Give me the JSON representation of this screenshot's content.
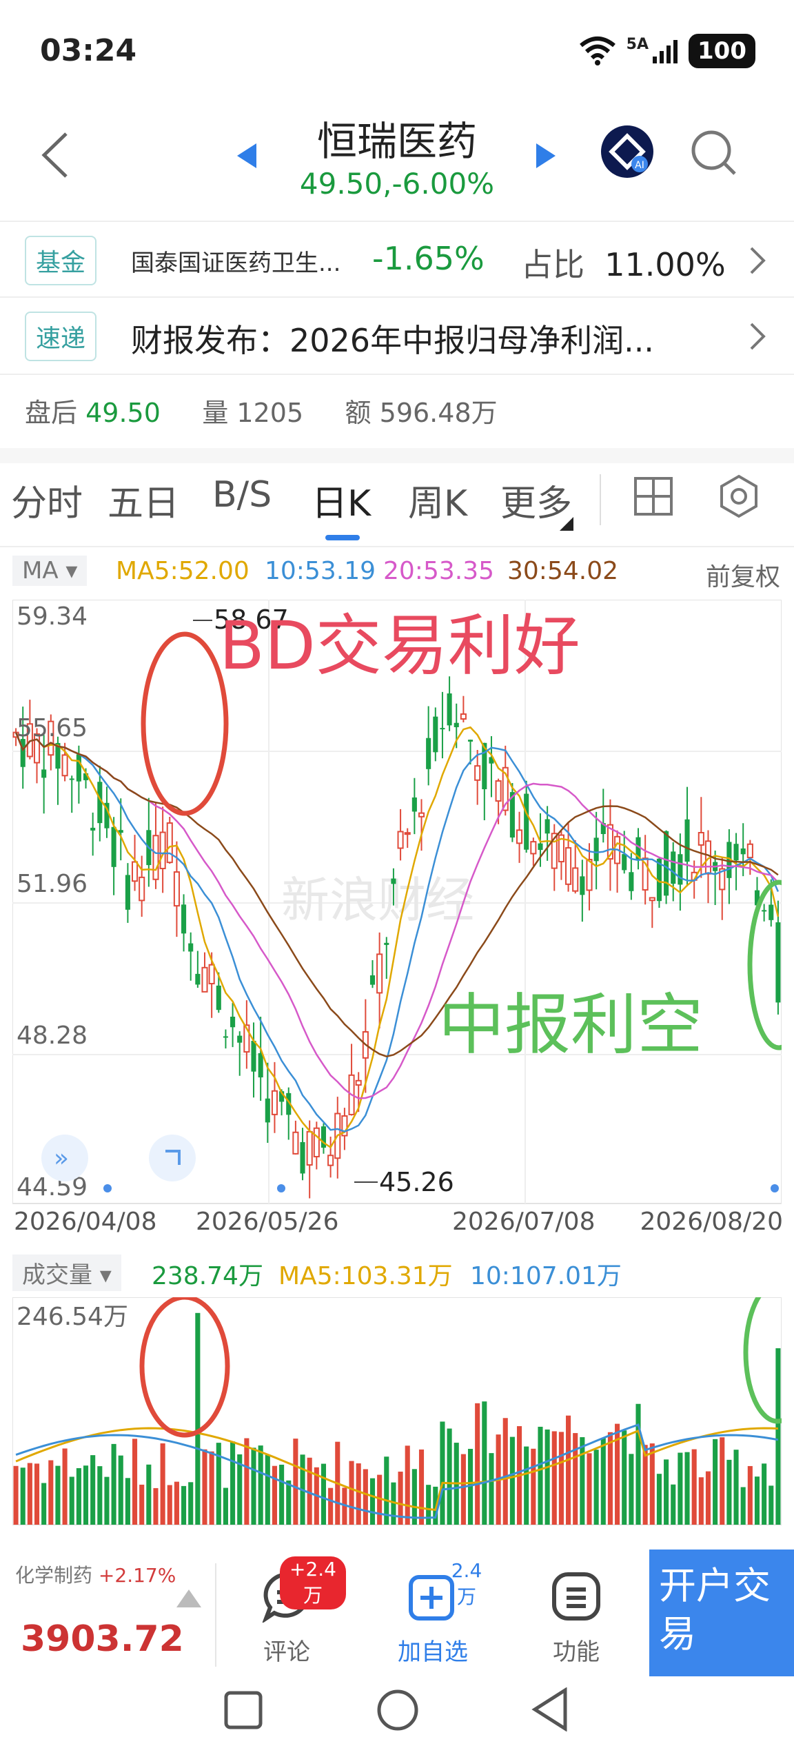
{
  "status": {
    "time": "03:24",
    "signal_label": "5A",
    "battery": "100"
  },
  "header": {
    "title": "恒瑞医药",
    "subtitle": "49.50,-6.00%"
  },
  "fund_row": {
    "tag": "基金",
    "name": "国泰国证医药卫生...",
    "change": "-1.65%",
    "ratio_label": "占比",
    "ratio_value": "11.00%"
  },
  "news_row": {
    "tag": "速递",
    "text": "财报发布：2026年中报归母净利润..."
  },
  "after_hours": {
    "label": "盘后",
    "price": "49.50",
    "vol_label": "量",
    "vol": "1205",
    "amt_label": "额",
    "amt": "596.48万"
  },
  "tabs": [
    "分时",
    "五日",
    "B/S",
    "日K",
    "周K",
    "更多"
  ],
  "ma_bar": {
    "chip": "MA ▾",
    "ma5": "MA5:52.00",
    "ma10": "10:53.19",
    "ma20": "20:53.35",
    "ma30": "30:54.02",
    "adjust": "前复权"
  },
  "price_axis": [
    "59.34",
    "55.65",
    "51.96",
    "48.28",
    "44.59"
  ],
  "price_marks": {
    "high": "58.67",
    "low": "45.26"
  },
  "annotations": {
    "good": "BD交易利好",
    "bad": "中报利空",
    "watermark": "新浪财经"
  },
  "dates": [
    "2026/04/08",
    "2026/05/26",
    "2026/07/08",
    "2026/08/20"
  ],
  "vol_bar": {
    "chip": "成交量 ▾",
    "vol": "238.74万",
    "ma5": "MA5:103.31万",
    "ma10": "10:107.01万",
    "axis_top": "246.54万"
  },
  "bottom": {
    "sector": "化学制药",
    "sector_chg": "+2.17%",
    "index": "3903.72",
    "comment": "评论",
    "comment_badge": "+2.4万",
    "add": "加自选",
    "add_badge": "2.4万",
    "func": "功能",
    "open": "开户交易"
  },
  "colors": {
    "up": "#e04a3a",
    "down": "#1aa047",
    "accent": "#2f7ee8",
    "ma5": "#e0a800",
    "ma10": "#3b8fd6",
    "ma20": "#d659c9",
    "ma30": "#8b4a1a"
  }
}
